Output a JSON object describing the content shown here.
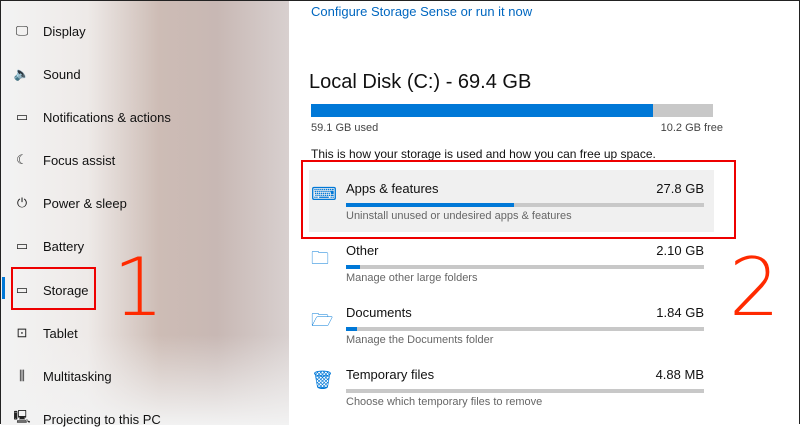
{
  "sidebar": {
    "items": [
      {
        "label": "Display",
        "icon": "monitor-icon"
      },
      {
        "label": "Sound",
        "icon": "speaker-icon"
      },
      {
        "label": "Notifications & actions",
        "icon": "message-icon"
      },
      {
        "label": "Focus assist",
        "icon": "moon-icon"
      },
      {
        "label": "Power & sleep",
        "icon": "power-icon"
      },
      {
        "label": "Battery",
        "icon": "battery-icon"
      },
      {
        "label": "Storage",
        "icon": "drive-icon",
        "selected": true
      },
      {
        "label": "Tablet",
        "icon": "tablet-icon"
      },
      {
        "label": "Multitasking",
        "icon": "multitasking-icon"
      },
      {
        "label": "Projecting to this PC",
        "icon": "projecting-icon"
      }
    ]
  },
  "annotations": {
    "step1": "1",
    "step2": "2",
    "highlight_color": "#e00000",
    "number_color": "#ff2a00"
  },
  "main": {
    "storage_sense_link": "Configure Storage Sense or run it now",
    "disk_title": "Local Disk (C:) - 69.4 GB",
    "used": "59.1 GB used",
    "free": "10.2 GB free",
    "used_percent": 85,
    "description": "This is how your storage is used and how you can free up space.",
    "categories": [
      {
        "name": "Apps & features",
        "size": "27.8 GB",
        "sub": "Uninstall unused or undesired apps & features",
        "percent": 47
      },
      {
        "name": "Other",
        "size": "2.10 GB",
        "sub": "Manage other large folders",
        "percent": 4
      },
      {
        "name": "Documents",
        "size": "1.84 GB",
        "sub": "Manage the Documents folder",
        "percent": 3
      },
      {
        "name": "Temporary files",
        "size": "4.88 MB",
        "sub": "Choose which temporary files to remove",
        "percent": 0
      }
    ]
  },
  "accent": "#0078d7"
}
